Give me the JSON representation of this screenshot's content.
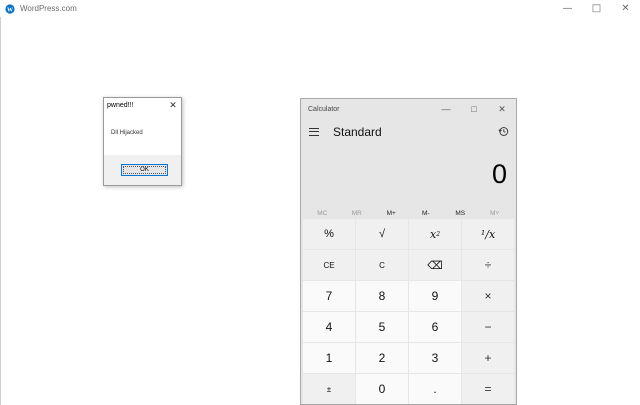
{
  "host": {
    "title": "WordPress.com",
    "controls": {
      "minimize": "—",
      "maximize": "□",
      "close": "✕"
    },
    "logo_color": "#0b72c4"
  },
  "msgbox": {
    "title": "pwned!!!",
    "close": "✕",
    "message": "Dll Hijacked",
    "ok": "OK"
  },
  "calculator": {
    "title": "Calculator",
    "controls": {
      "minimize": "—",
      "maximize": "□",
      "close": "✕"
    },
    "mode": "Standard",
    "display": "0",
    "memory": [
      {
        "label": "MC",
        "enabled": false
      },
      {
        "label": "MR",
        "enabled": false
      },
      {
        "label": "M+",
        "enabled": true
      },
      {
        "label": "M-",
        "enabled": true
      },
      {
        "label": "MS",
        "enabled": true
      },
      {
        "label": "M˅",
        "enabled": false
      }
    ],
    "keys": [
      [
        "%",
        "√",
        "x²",
        "¹/x"
      ],
      [
        "CE",
        "C",
        "⌫",
        "÷"
      ],
      [
        "7",
        "8",
        "9",
        "×"
      ],
      [
        "4",
        "5",
        "6",
        "−"
      ],
      [
        "1",
        "2",
        "3",
        "+"
      ],
      [
        "±",
        "0",
        ".",
        "="
      ]
    ]
  }
}
